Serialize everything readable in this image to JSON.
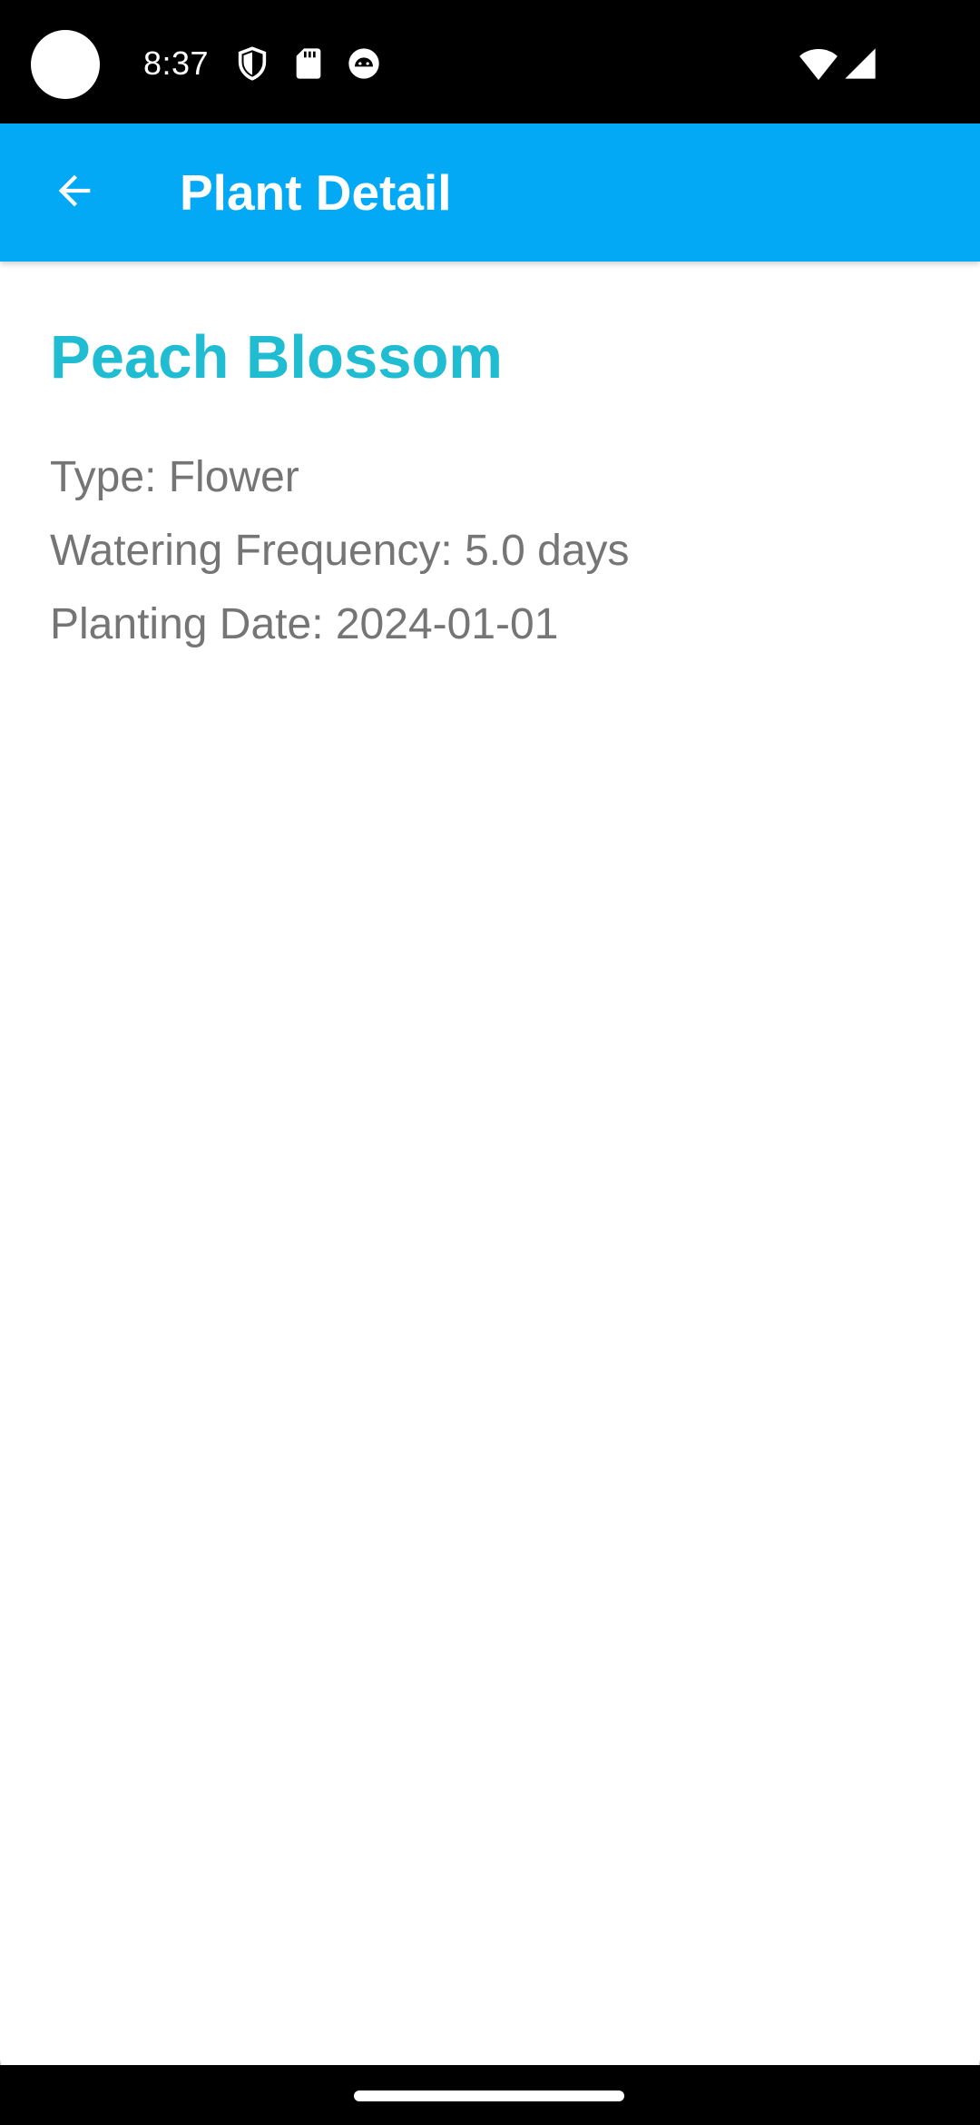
{
  "status_bar": {
    "time": "8:37",
    "icons": [
      "shield-icon",
      "sd-card-icon",
      "android-face-icon",
      "wifi-icon",
      "cell-signal-icon"
    ]
  },
  "app_bar": {
    "title": "Plant Detail",
    "back_icon": "arrow-back-icon",
    "color": "#03A9F4"
  },
  "plant": {
    "name": "Peach Blossom",
    "name_color": "#1FBCD2",
    "type_line": "Type: Flower",
    "watering_line": "Watering Frequency: 5.0 days",
    "planting_date_line": "Planting Date: 2024-01-01"
  }
}
